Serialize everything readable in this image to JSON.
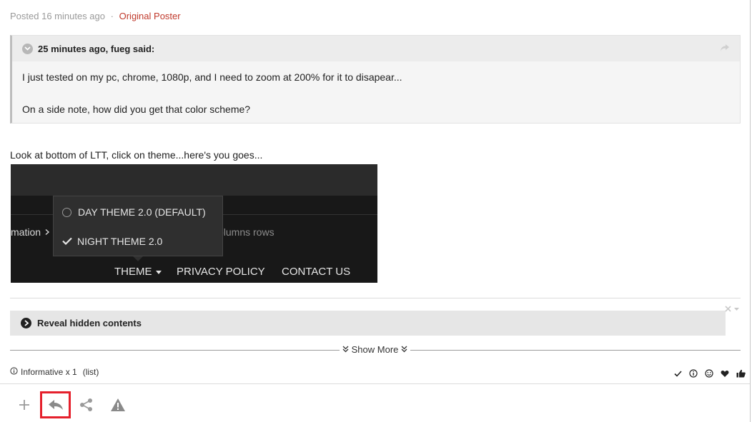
{
  "post": {
    "posted_label": "Posted",
    "posted_time": "16 minutes ago",
    "separator": "·",
    "author_badge": "Original Poster"
  },
  "quote": {
    "citation": "25 minutes ago, fueg said:",
    "line1": "I just tested on my pc, chrome, 1080p, and I need to zoom at 200% for it to disapear...",
    "line2": "On a side note, how did you get that color scheme?"
  },
  "reply": {
    "text": "Look at bottom of LTT, click on theme...here's you goes..."
  },
  "screenshot": {
    "breadcrumb": "mation",
    "faded_text": "olumns rows",
    "menu_option_day": "DAY THEME 2.0 (DEFAULT)",
    "menu_option_night": "NIGHT THEME 2.0",
    "footer_theme": "THEME",
    "footer_privacy": "PRIVACY POLICY",
    "footer_contact": "CONTACT US"
  },
  "spoiler": {
    "label": "Reveal hidden contents"
  },
  "show_more": "Show More",
  "reactions": {
    "summary": "Informative x 1",
    "list_link": "(list)"
  },
  "icons": {
    "quote_toggle": "chevron-down-icon",
    "quote_share": "share-arrow-icon",
    "reveal": "chevron-right-icon",
    "actions": [
      "plus-icon",
      "reply-icon",
      "share-icon",
      "warning-icon"
    ],
    "reactions": [
      "check-icon",
      "info-icon",
      "smiley-icon",
      "heart-icon",
      "thumbs-up-icon"
    ]
  },
  "colors": {
    "op_badge": "#c0392b",
    "highlight": "#e5202c"
  }
}
